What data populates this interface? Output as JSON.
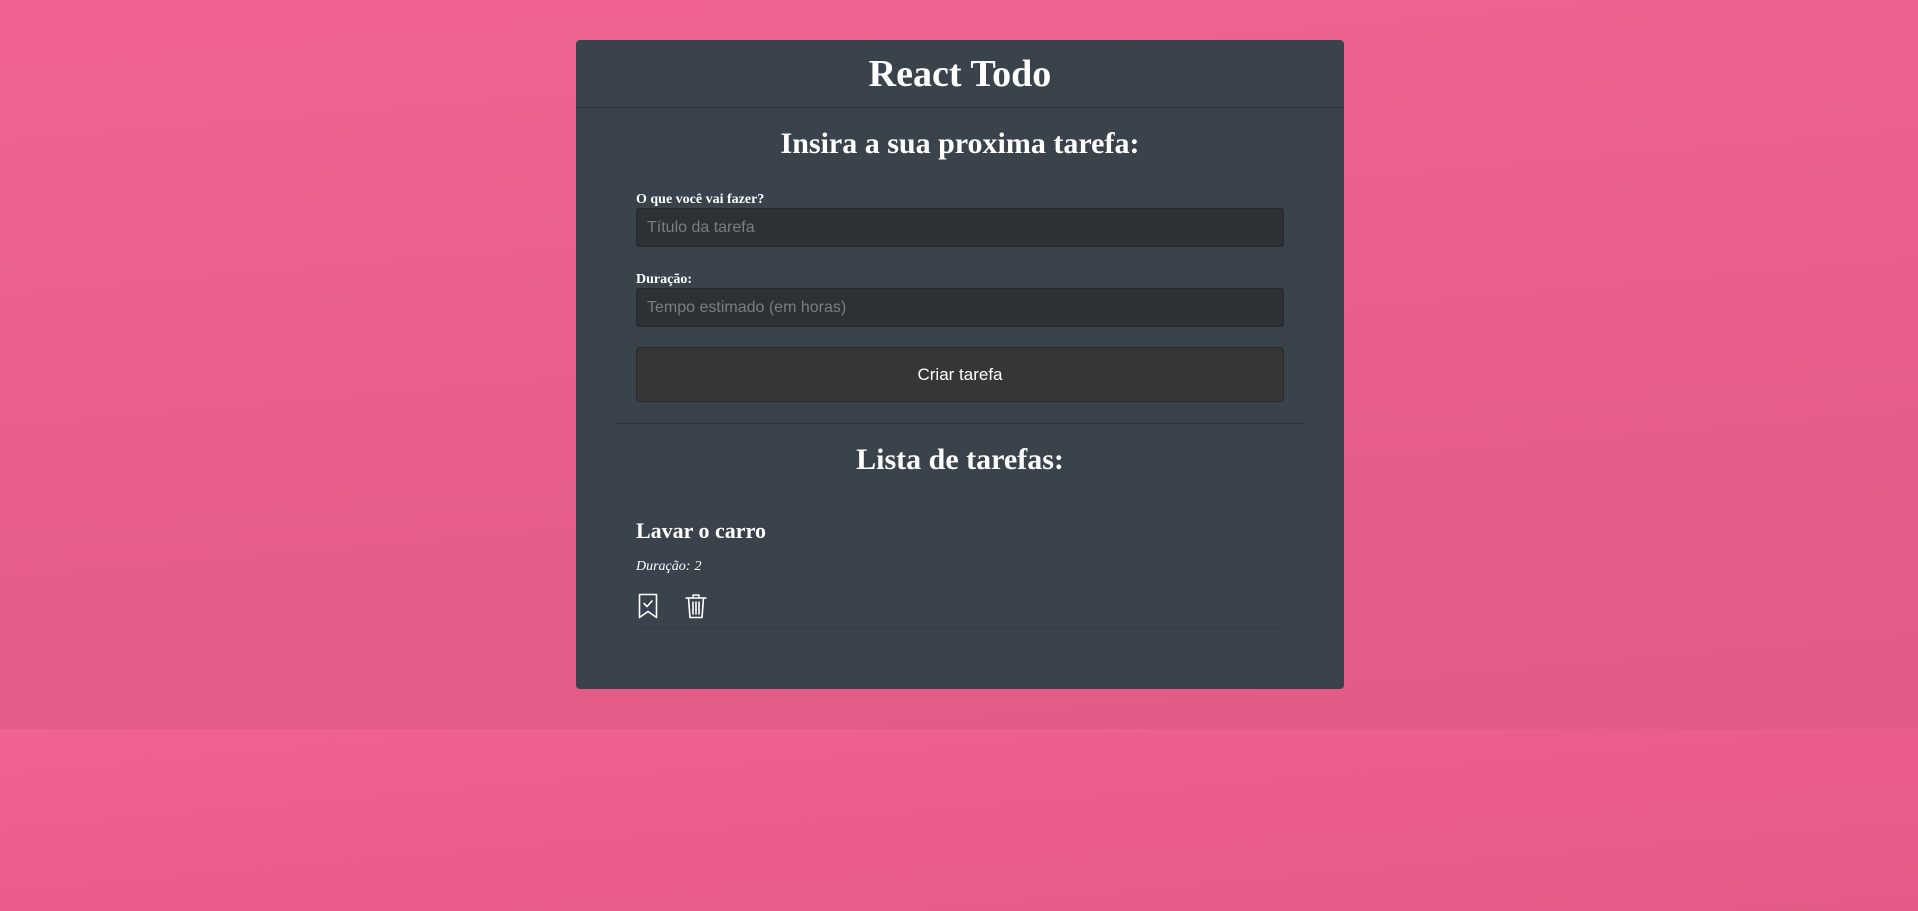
{
  "app": {
    "title": "React Todo"
  },
  "form": {
    "title": "Insira a sua proxima tarefa:",
    "title_label": "O que você vai fazer?",
    "title_placeholder": "Título da tarefa",
    "title_value": "",
    "duration_label": "Duração:",
    "duration_placeholder": "Tempo estimado (em horas)",
    "duration_value": "",
    "submit_label": "Criar tarefa"
  },
  "list": {
    "title": "Lista de tarefas:",
    "duration_prefix": "Duração:",
    "tasks": [
      {
        "title": "Lavar o carro",
        "duration": "2",
        "icons": [
          "bookmark-check-icon",
          "trash-icon"
        ]
      }
    ]
  },
  "colors": {
    "background": "#ea5f8c",
    "card": "#3a424c",
    "input": "#2d3035",
    "button": "#363636",
    "text": "#ffffff"
  }
}
